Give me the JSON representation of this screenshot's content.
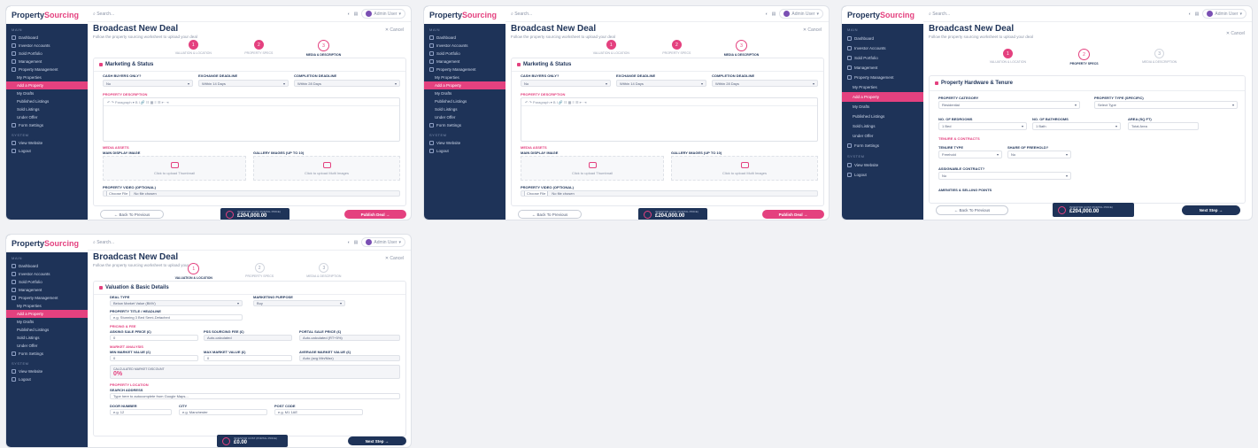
{
  "brand": {
    "name_a": "Property",
    "name_b": "Sourcing",
    "tagline": "On-Demand Deal Engine Services"
  },
  "topbar": {
    "search_placeholder": "Search...",
    "user_name": "Admin User"
  },
  "sidebar": {
    "section_main": "MAIN",
    "section_system": "SYSTEM",
    "items": {
      "dashboard": "Dashboard",
      "investor_accounts": "Investor Accounts",
      "sold_portfolio": "Sold Portfolio",
      "management": "Management",
      "property_management": "Property Management",
      "my_properties": "My Properties",
      "add_property": "Add a Property",
      "my_drafts": "My Drafts",
      "published_listings": "Published Listings",
      "sold_listings": "Sold Listings",
      "under_offer": "Under Offer",
      "form_settings": "Form Settings",
      "view_website": "View Website",
      "logout": "Logout"
    }
  },
  "page": {
    "title": "Broadcast New Deal",
    "subtitle": "Follow the property sourcing worksheet to upload your deal",
    "cancel": "✕ Cancel"
  },
  "steps": {
    "s1": {
      "num": "1",
      "label": "VALUATION & LOCATION"
    },
    "s2": {
      "num": "2",
      "label": "PROPERTY SPECS"
    },
    "s3": {
      "num": "3",
      "label": "MEDIA & DESCRIPTION"
    }
  },
  "marketing": {
    "header": "Marketing & Status",
    "cash_buyers_label": "CASH BUYERS ONLY?",
    "cash_buyers_value": "No",
    "exchange_label": "EXCHANGE DEADLINE",
    "exchange_value": "Within 14 Days",
    "completion_label": "COMPLETION DEADLINE",
    "completion_value": "Within 28 Days",
    "description_section": "PROPERTY DESCRIPTION",
    "editor_toolbar": "↶  ↷   Paragraph   ▾   B   I   🔗   ☷   ▦   ≡   ☰   ⇤   ⇥",
    "media_section": "MEDIA ASSETS",
    "main_image_label": "MAIN DISPLAY IMAGE",
    "main_image_text": "Click to upload Thumbnail",
    "gallery_label": "GALLERY IMAGES (UP TO 10)",
    "gallery_text": "Click to upload Multi Images",
    "video_label": "PROPERTY VIDEO (OPTIONAL)",
    "choose_file": "Choose File",
    "no_file": "No file chosen"
  },
  "hardware": {
    "header": "Property Hardware & Tenure",
    "category_label": "PROPERTY CATEGORY",
    "category_value": "Residential",
    "type_label": "PROPERTY TYPE (SPECIFIC)",
    "type_value": "Select Type",
    "bedrooms_label": "NO. OF BEDROOMS",
    "bedrooms_value": "1 Bed",
    "bathrooms_label": "NO. OF BATHROOMS",
    "bathrooms_value": "1 Bath",
    "area_label": "AREA (SQ FT)",
    "area_placeholder": "Total Area",
    "tenure_section": "TENURE & CONTRACTS",
    "tenure_label": "TENURE TYPE",
    "tenure_value": "Freehold",
    "share_label": "SHARE OF FREEHOLD?",
    "share_value": "No",
    "assignable_label": "ASSIGNABLE CONTRACT?",
    "assignable_value": "No",
    "amenities_label": "AMENITIES & SELLING POINTS"
  },
  "valuation": {
    "header": "Valuation & Basic Details",
    "deal_type_label": "DEAL TYPE",
    "deal_type_value": "Below Market Value (BMV)",
    "purpose_label": "MARKETING PURPOSE",
    "purpose_value": "Buy",
    "title_label": "PROPERTY TITLE / HEADLINE",
    "title_placeholder": "e.g. Stunning 3 Bed Semi-Detached",
    "pricing_section": "PRICING & FEE",
    "asking_label": "ASKING SALE PRICE (£)",
    "asking_value": "0",
    "fee_label": "PSS SOURCING FEE (£)",
    "fee_value": "Auto-calculated",
    "portal_label": "PORTAL SALE PRICE (£)",
    "portal_value": "Auto-calculated (RT+5%)",
    "market_section": "MARKET ANALYSIS",
    "min_label": "MIN MARKET VALUE (£)",
    "min_value": "0",
    "max_label": "MAX MARKET VALUE (£)",
    "max_value": "0",
    "avg_label": "AVERAGE MARKET VALUE (£)",
    "avg_value": "Auto (avg Min/Max)",
    "discount_label": "CALCULATED MARKET DISCOUNT",
    "discount_value": "0%",
    "location_section": "PROPERTY LOCATION",
    "search_label": "SEARCH ADDRESS",
    "search_placeholder": "Type here to autocomplete from Google Maps...",
    "door_label": "DOOR NUMBER",
    "door_placeholder": "e.g. 12",
    "city_label": "CITY",
    "city_placeholder": "e.g. Manchester",
    "post_label": "POST CODE",
    "post_placeholder": "e.g. M1 1AE"
  },
  "footer": {
    "back": "← Back To Previous",
    "price_label": "INVESTOR COST (PORTAL PRICE)",
    "price_value_a": "£204,000.00",
    "price_value_c": "£204,000.00",
    "price_value_d": "£0.00",
    "publish": "Publish Deal →",
    "next": "Next Step →"
  },
  "colors": {
    "navy": "#1e3358",
    "pink": "#e4417f"
  }
}
